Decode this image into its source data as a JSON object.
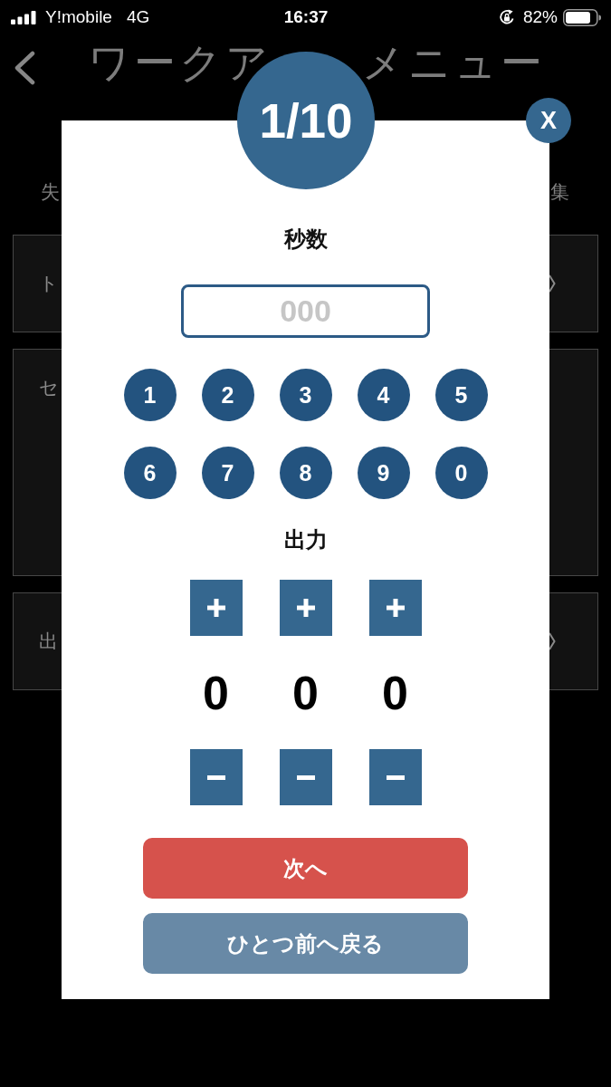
{
  "status_bar": {
    "carrier": "Y!mobile",
    "network": "4G",
    "time": "16:37",
    "battery": "82%"
  },
  "header": {
    "title_parts": [
      "ワークア",
      "メニュー"
    ]
  },
  "background_labels": [
    "失",
    "集"
  ],
  "background_cards": [
    {
      "label": "ト",
      "kind": "link"
    },
    {
      "label": "セ",
      "kind": "panel"
    },
    {
      "label": "出",
      "kind": "link"
    }
  ],
  "dialog": {
    "counter": "1/10",
    "close": "X",
    "seconds": {
      "label": "秒数",
      "field": {
        "placeholder": "000"
      }
    },
    "keypad": [
      "1",
      "2",
      "3",
      "4",
      "5",
      "6",
      "7",
      "8",
      "9",
      "0"
    ],
    "output": {
      "label": "出力",
      "digits": [
        {
          "value": "0"
        },
        {
          "value": "0"
        },
        {
          "value": "0"
        }
      ]
    },
    "buttons": [
      {
        "label": "次へ",
        "kind": "primary"
      },
      {
        "label": "ひとつ前へ戻る",
        "kind": "secondary"
      }
    ]
  }
}
